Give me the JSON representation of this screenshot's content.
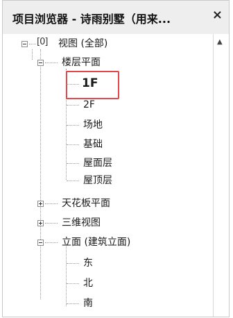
{
  "window": {
    "title": "项目浏览器 - 诗雨别墅（用来...",
    "close_label": "×"
  },
  "tree": {
    "root": {
      "icon": "[0]",
      "label": "视图 (全部)"
    },
    "floor_plans": {
      "label": "楼层平面",
      "items": [
        "1F",
        "2F",
        "场地",
        "基础",
        "屋面层",
        "屋顶层"
      ]
    },
    "ceiling_plans": {
      "label": "天花板平面"
    },
    "views_3d": {
      "label": "三维视图"
    },
    "elevations": {
      "label": "立面 (建筑立面)",
      "items": [
        "东",
        "北",
        "南"
      ]
    }
  },
  "selected_item": "1F",
  "highlight_color": "#e0464a",
  "icons": {
    "collapse": "minus-box-icon",
    "expand": "plus-box-icon",
    "views": "view-bracket-icon",
    "scroll_up": "chevron-up-icon",
    "close": "close-icon"
  }
}
